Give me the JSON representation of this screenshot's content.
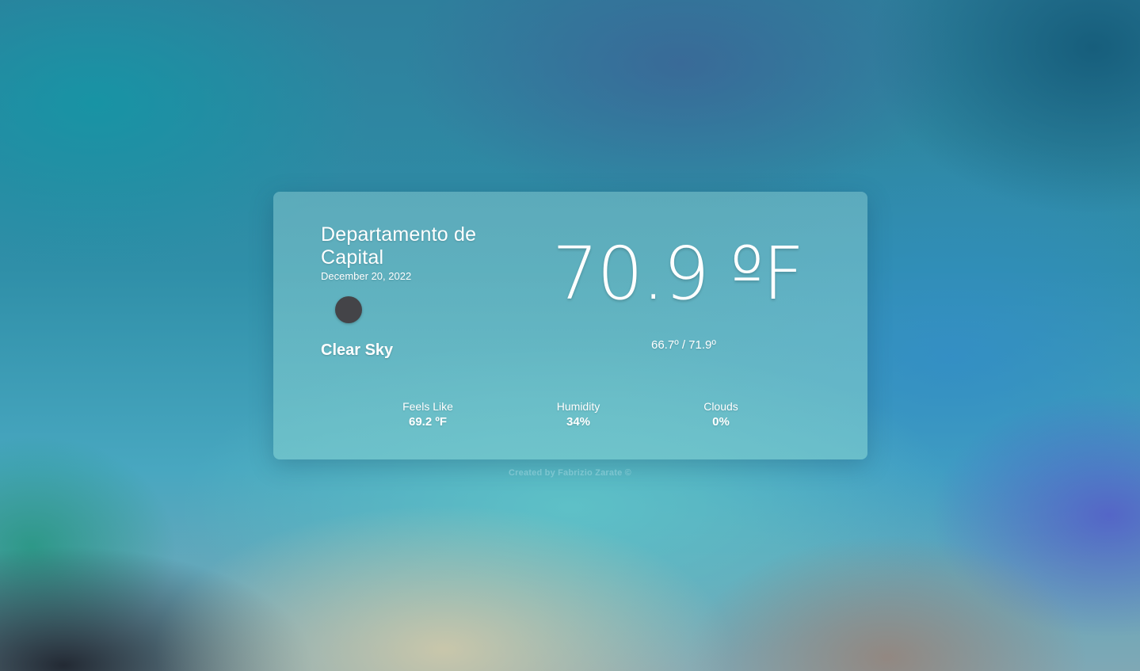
{
  "location": {
    "city": "Departamento de Capital",
    "date": "December 20, 2022"
  },
  "current": {
    "icon": "weather-icon-dark-circle",
    "description": "Clear Sky",
    "temperature": "70.9 ºF",
    "min_max": "66.7º / 71.9º"
  },
  "stats": {
    "feels_like": {
      "label": "Feels Like",
      "value": "69.2 ºF"
    },
    "humidity": {
      "label": "Humidity",
      "value": "34%"
    },
    "clouds": {
      "label": "Clouds",
      "value": "0%"
    }
  },
  "footer": {
    "credit": "Created by Fabrizio Zarate ©"
  },
  "colors": {
    "card_tint": "#7cc4cc",
    "icon": "#444448",
    "text": "#ffffff"
  }
}
